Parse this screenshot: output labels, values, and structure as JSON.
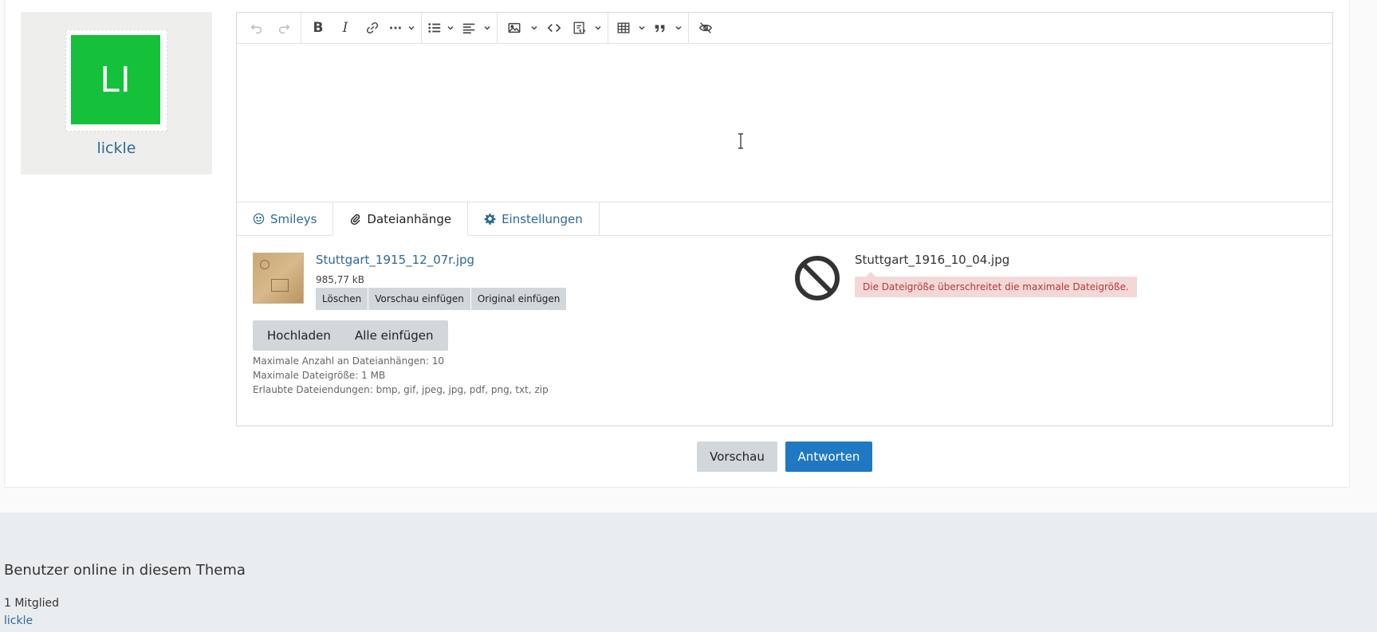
{
  "user": {
    "initials": "LI",
    "name": "lickle",
    "avatar_color": "#15c03a"
  },
  "toolbar": {
    "icons": [
      "undo-icon",
      "redo-icon",
      "bold-icon",
      "italic-icon",
      "link-icon",
      "more-icon",
      "list-icon",
      "align-icon",
      "image-icon",
      "code-icon",
      "code-block-icon",
      "table-icon",
      "quote-icon",
      "spoiler-icon"
    ]
  },
  "tabs": [
    {
      "label": "Smileys",
      "icon": "smiley-icon"
    },
    {
      "label": "Dateianhänge",
      "icon": "paperclip-icon"
    },
    {
      "label": "Einstellungen",
      "icon": "gear-icon"
    }
  ],
  "attachment": {
    "filename": "Stuttgart_1915_12_07r.jpg",
    "size": "985,77 kB",
    "actions": [
      "Löschen",
      "Vorschau einfügen",
      "Original einfügen"
    ]
  },
  "failed_attachment": {
    "filename": "Stuttgart_1916_10_04.jpg",
    "error": "Die Dateigröße überschreitet die maximale Dateigröße."
  },
  "upload": {
    "upload_label": "Hochladen",
    "insert_all_label": "Alle einfügen"
  },
  "limits": {
    "max_count": "Maximale Anzahl an Dateianhängen: 10",
    "max_size": "Maximale Dateigröße: 1 MB",
    "extensions": "Erlaubte Dateiendungen: bmp, gif, jpeg, jpg, pdf, png, txt, zip"
  },
  "form": {
    "preview_label": "Vorschau",
    "submit_label": "Antworten"
  },
  "colors": {
    "primary": "#1f78c2",
    "link": "#2e6a94",
    "error_bg": "#f4d8d8",
    "error_text": "#b33a3a"
  },
  "footer": {
    "title": "Benutzer online in diesem Thema",
    "count": "1 Mitglied",
    "user": "lickle"
  }
}
